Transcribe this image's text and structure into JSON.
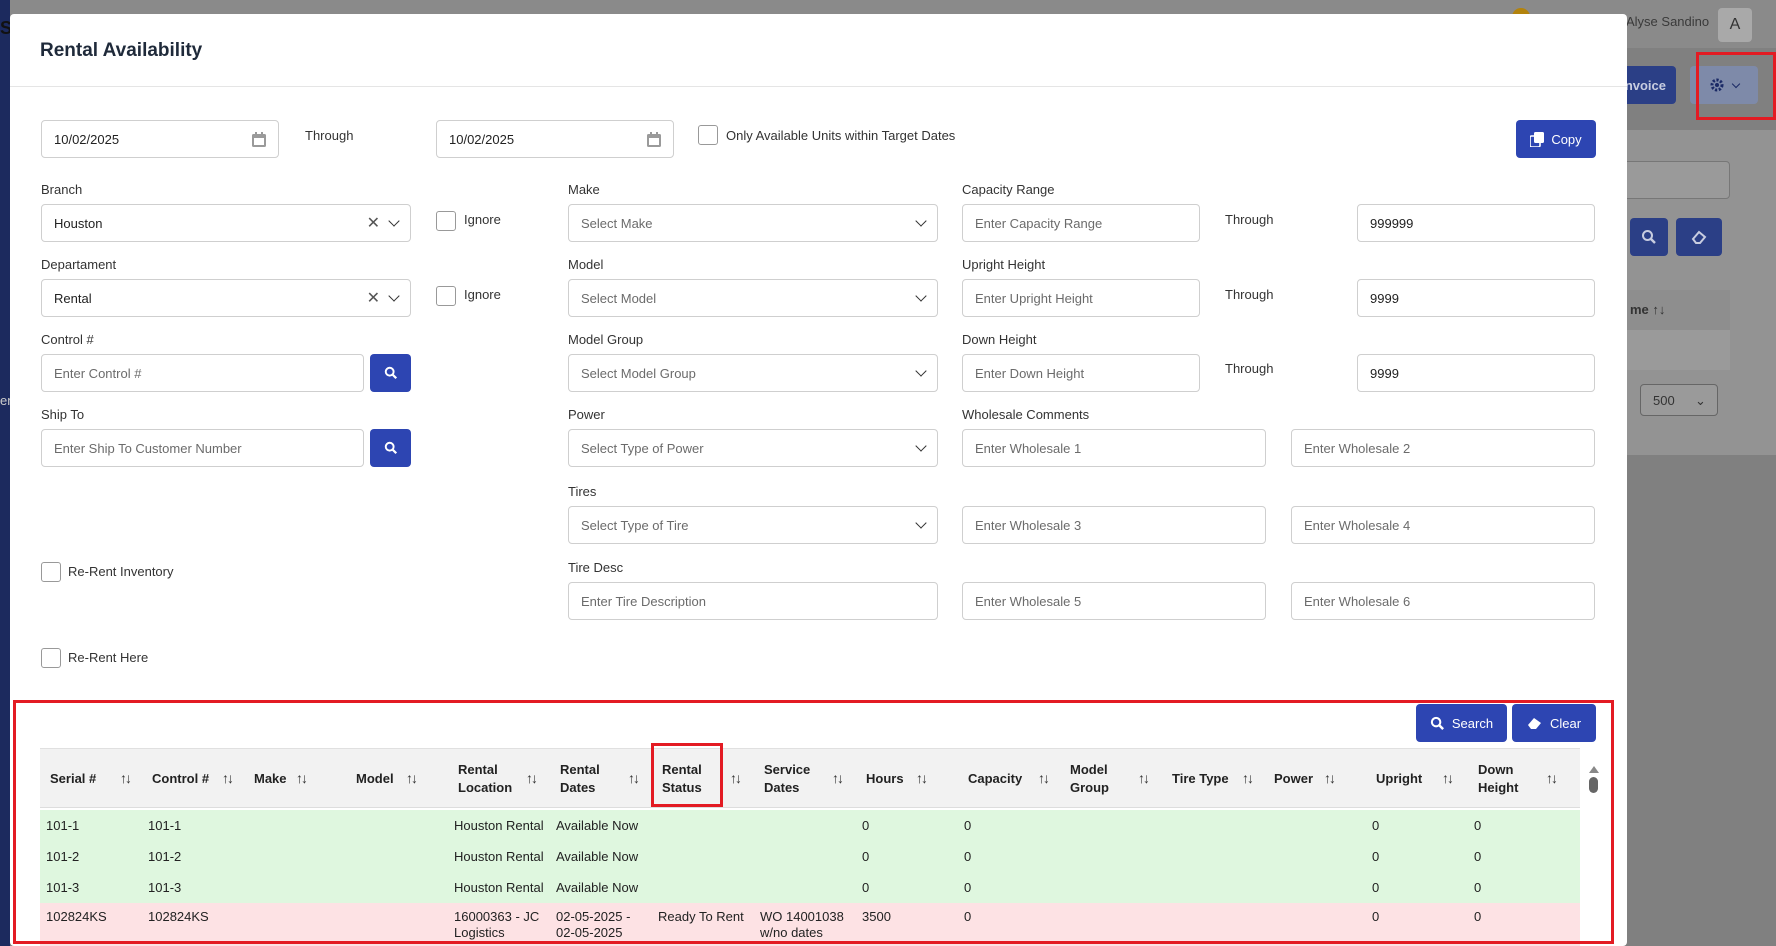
{
  "background": {
    "user_name": "Alyse Sandino",
    "avatar_letter": "A",
    "invoice_label": "Invoice",
    "table_header_fragment": "me",
    "page_size": "500",
    "side_text": "en"
  },
  "modal": {
    "title": "Rental Availability",
    "date_from": "10/02/2025",
    "through_label": "Through",
    "date_to": "10/02/2025",
    "only_available_label": "Only Available Units within Target Dates",
    "copy_label": "Copy",
    "branch": {
      "label": "Branch",
      "value": "Houston",
      "ignore_label": "Ignore"
    },
    "department": {
      "label": "Departament",
      "value": "Rental",
      "ignore_label": "Ignore"
    },
    "control": {
      "label": "Control #",
      "placeholder": "Enter Control #"
    },
    "ship_to": {
      "label": "Ship To",
      "placeholder": "Enter Ship To Customer Number"
    },
    "re_rent_inventory_label": "Re-Rent Inventory",
    "re_rent_here_label": "Re-Rent Here",
    "make": {
      "label": "Make",
      "placeholder": "Select Make"
    },
    "model": {
      "label": "Model",
      "placeholder": "Select Model"
    },
    "model_group": {
      "label": "Model Group",
      "placeholder": "Select Model Group"
    },
    "power": {
      "label": "Power",
      "placeholder": "Select Type of Power"
    },
    "tires": {
      "label": "Tires",
      "placeholder": "Select Type of Tire"
    },
    "tire_desc": {
      "label": "Tire Desc",
      "placeholder": "Enter Tire Description"
    },
    "capacity": {
      "label": "Capacity Range",
      "placeholder": "Enter Capacity Range",
      "through": "Through",
      "to_value": "999999"
    },
    "upright": {
      "label": "Upright Height",
      "placeholder": "Enter Upright Height",
      "through": "Through",
      "to_value": "9999"
    },
    "down": {
      "label": "Down Height",
      "placeholder": "Enter Down Height",
      "through": "Through",
      "to_value": "9999"
    },
    "wholesale": {
      "label": "Wholesale Comments",
      "placeholders": [
        "Enter Wholesale 1",
        "Enter Wholesale 2",
        "Enter Wholesale 3",
        "Enter Wholesale 4",
        "Enter Wholesale 5",
        "Enter Wholesale 6"
      ]
    },
    "search_label": "Search",
    "clear_label": "Clear",
    "table": {
      "sort_glyph": "↑↓",
      "columns": [
        [
          "Serial #",
          ""
        ],
        [
          "Control #",
          ""
        ],
        [
          "Make",
          ""
        ],
        [
          "Model",
          ""
        ],
        [
          "Rental",
          "Location"
        ],
        [
          "Rental",
          "Dates"
        ],
        [
          "Rental",
          "Status"
        ],
        [
          "Service",
          "Dates"
        ],
        [
          "Hours",
          ""
        ],
        [
          "Capacity",
          ""
        ],
        [
          "Model",
          "Group"
        ],
        [
          "Tire Type",
          ""
        ],
        [
          "Power",
          ""
        ],
        [
          "Upright",
          ""
        ],
        [
          "Down",
          "Height"
        ]
      ],
      "rows": [
        {
          "status": "available",
          "cells": [
            "101-1",
            "101-1",
            "",
            "",
            "Houston Rental",
            "Available Now",
            "",
            "",
            "0",
            "0",
            "",
            "",
            "",
            "0",
            "0"
          ]
        },
        {
          "status": "available",
          "cells": [
            "101-2",
            "101-2",
            "",
            "",
            "Houston Rental",
            "Available Now",
            "",
            "",
            "0",
            "0",
            "",
            "",
            "",
            "0",
            "0"
          ]
        },
        {
          "status": "available",
          "cells": [
            "101-3",
            "101-3",
            "",
            "",
            "Houston Rental",
            "Available Now",
            "",
            "",
            "0",
            "0",
            "",
            "",
            "",
            "0",
            "0"
          ]
        },
        {
          "status": "rented",
          "cells": [
            "102824KS",
            "102824KS",
            "",
            "",
            "16000363 - JC\nLogistics",
            "02-05-2025 -\n02-05-2025",
            "Ready To Rent",
            "WO 14001038\nw/no dates",
            "3500",
            "0",
            "",
            "",
            "",
            "0",
            "0"
          ]
        }
      ]
    }
  }
}
